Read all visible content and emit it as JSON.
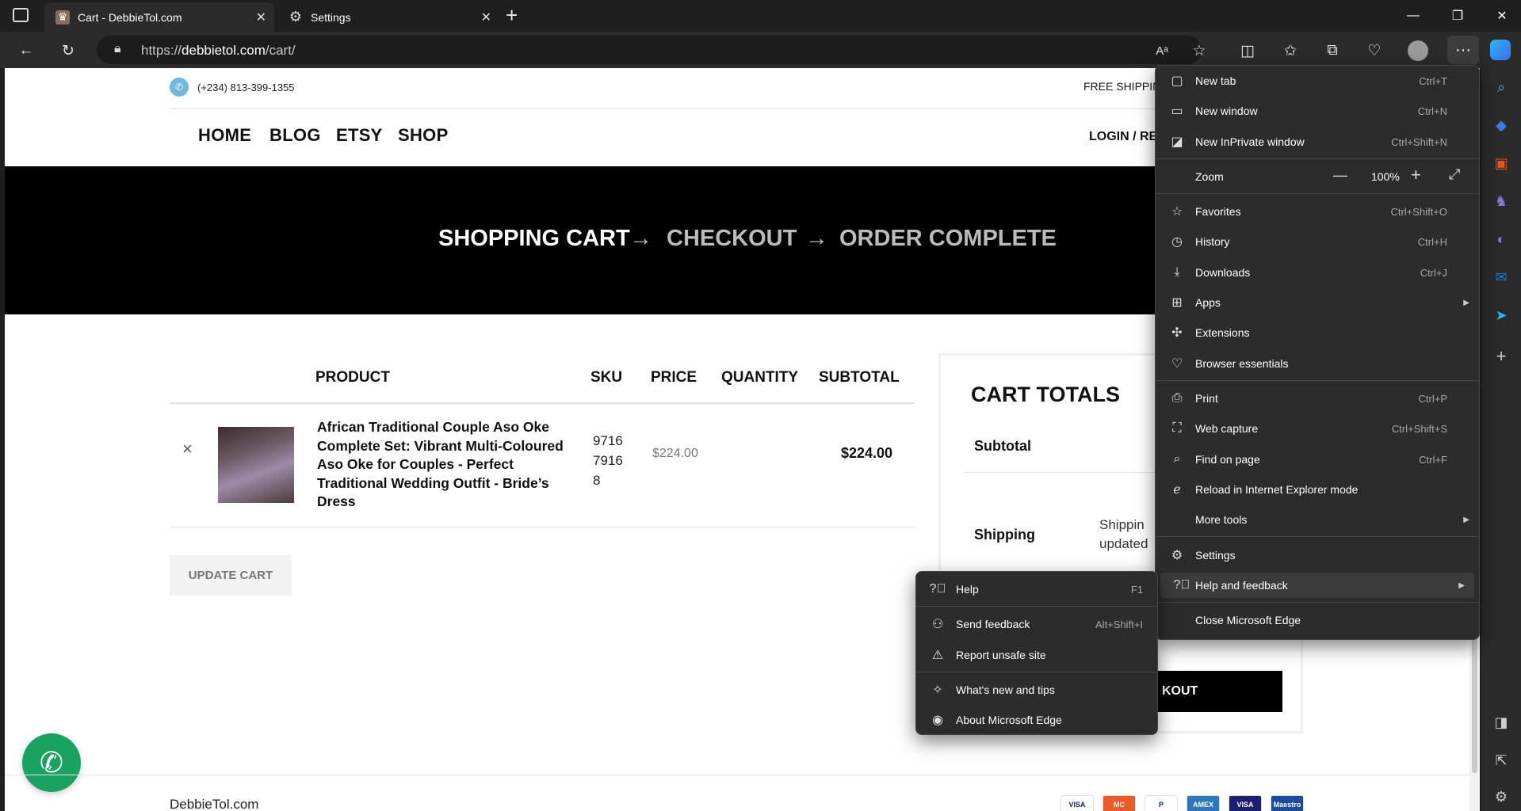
{
  "browser": {
    "tabs": [
      {
        "title": "Cart - DebbieTol.com",
        "icon": "site-favicon"
      },
      {
        "title": "Settings",
        "icon": "gear-icon"
      }
    ],
    "url_prefix": "https://",
    "url_domain": "debbietol.com",
    "url_path": "/cart/"
  },
  "site": {
    "phone": "(+234) 813-399-1355",
    "free_shipping": "FREE SHIPPIN",
    "nav": [
      "HOME",
      "BLOG",
      "ETSY",
      "SHOP"
    ],
    "login": "LOGIN / RE",
    "steps": [
      "SHOPPING CART",
      "CHECKOUT",
      "ORDER COMPLETE"
    ],
    "arrow": "→",
    "table_headers": [
      "PRODUCT",
      "SKU",
      "PRICE",
      "QUANTITY",
      "SUBTOTAL"
    ],
    "item": {
      "name": "African Traditional Couple Aso Oke Complete Set: Vibrant Multi-Coloured Aso Oke for Couples - Perfect Traditional Wedding Outfit - Bride’s Dress",
      "sku_lines": [
        "9716",
        "7916",
        "8"
      ],
      "price": "$224.00",
      "subtotal": "$224.00",
      "remove": "×"
    },
    "update_cart": "UPDATE CART",
    "totals_title": "CART TOTALS",
    "subtotal_label": "Subtotal",
    "shipping_label": "Shipping",
    "shipping_text_1": "Shippin",
    "shipping_text_2": "updated",
    "checkout_btn": "KOUT",
    "footer_brand": "DebbieTol.com",
    "payments": [
      "VISA",
      "MC",
      "P",
      "AMEX",
      "VISA",
      "Maestro"
    ]
  },
  "edge_menu": {
    "items": [
      {
        "label": "New tab",
        "shortcut": "Ctrl+T",
        "icon": "new-tab-icon"
      },
      {
        "label": "New window",
        "shortcut": "Ctrl+N",
        "icon": "new-window-icon"
      },
      {
        "label": "New InPrivate window",
        "shortcut": "Ctrl+Shift+N",
        "icon": "inprivate-icon"
      },
      {
        "label": "Zoom",
        "value": "100%"
      },
      {
        "label": "Favorites",
        "shortcut": "Ctrl+Shift+O",
        "icon": "star-icon"
      },
      {
        "label": "History",
        "shortcut": "Ctrl+H",
        "icon": "history-icon"
      },
      {
        "label": "Downloads",
        "shortcut": "Ctrl+J",
        "icon": "download-icon"
      },
      {
        "label": "Apps",
        "icon": "apps-icon"
      },
      {
        "label": "Extensions",
        "icon": "extensions-icon"
      },
      {
        "label": "Browser essentials",
        "icon": "heart-pulse-icon"
      },
      {
        "label": "Print",
        "shortcut": "Ctrl+P",
        "icon": "print-icon"
      },
      {
        "label": "Web capture",
        "shortcut": "Ctrl+Shift+S",
        "icon": "web-capture-icon"
      },
      {
        "label": "Find on page",
        "shortcut": "Ctrl+F",
        "icon": "find-icon"
      },
      {
        "label": "Reload in Internet Explorer mode",
        "icon": "ie-icon"
      },
      {
        "label": "More tools"
      },
      {
        "label": "Settings",
        "icon": "gear-icon"
      },
      {
        "label": "Help and feedback",
        "icon": "help-icon"
      },
      {
        "label": "Close Microsoft Edge"
      }
    ]
  },
  "help_menu": {
    "items": [
      {
        "label": "Help",
        "shortcut": "F1",
        "icon": "help-icon"
      },
      {
        "label": "Send feedback",
        "shortcut": "Alt+Shift+I",
        "icon": "feedback-icon"
      },
      {
        "label": "Report unsafe site",
        "icon": "warning-icon"
      },
      {
        "label": "What's new and tips",
        "icon": "tips-icon"
      },
      {
        "label": "About Microsoft Edge",
        "icon": "edge-logo-icon"
      }
    ]
  }
}
